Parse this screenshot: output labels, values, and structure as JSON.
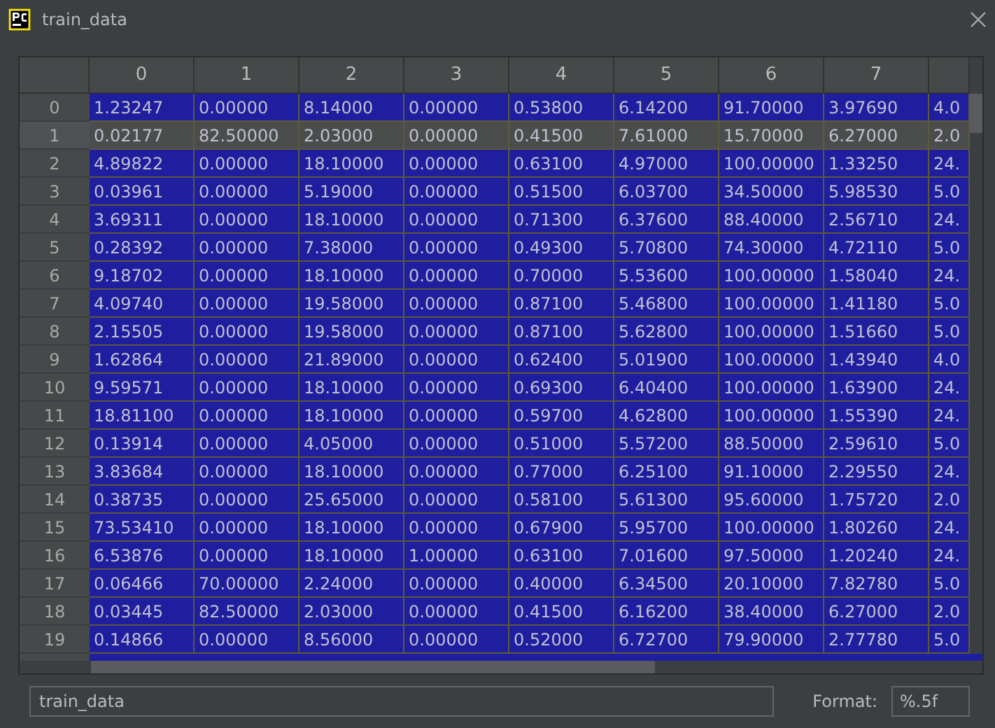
{
  "window": {
    "title": "train_data"
  },
  "table": {
    "columns": [
      "0",
      "1",
      "2",
      "3",
      "4",
      "5",
      "6",
      "7"
    ],
    "rows": [
      {
        "index": "0",
        "selected": false,
        "cells": [
          "1.23247",
          "0.00000",
          "8.14000",
          "0.00000",
          "0.53800",
          "6.14200",
          "91.70000",
          "3.97690",
          "4.0"
        ]
      },
      {
        "index": "1",
        "selected": true,
        "cells": [
          "0.02177",
          "82.50000",
          "2.03000",
          "0.00000",
          "0.41500",
          "7.61000",
          "15.70000",
          "6.27000",
          "2.0"
        ]
      },
      {
        "index": "2",
        "selected": false,
        "cells": [
          "4.89822",
          "0.00000",
          "18.10000",
          "0.00000",
          "0.63100",
          "4.97000",
          "100.00000",
          "1.33250",
          "24."
        ]
      },
      {
        "index": "3",
        "selected": false,
        "cells": [
          "0.03961",
          "0.00000",
          "5.19000",
          "0.00000",
          "0.51500",
          "6.03700",
          "34.50000",
          "5.98530",
          "5.0"
        ]
      },
      {
        "index": "4",
        "selected": false,
        "cells": [
          "3.69311",
          "0.00000",
          "18.10000",
          "0.00000",
          "0.71300",
          "6.37600",
          "88.40000",
          "2.56710",
          "24."
        ]
      },
      {
        "index": "5",
        "selected": false,
        "cells": [
          "0.28392",
          "0.00000",
          "7.38000",
          "0.00000",
          "0.49300",
          "5.70800",
          "74.30000",
          "4.72110",
          "5.0"
        ]
      },
      {
        "index": "6",
        "selected": false,
        "cells": [
          "9.18702",
          "0.00000",
          "18.10000",
          "0.00000",
          "0.70000",
          "5.53600",
          "100.00000",
          "1.58040",
          "24."
        ]
      },
      {
        "index": "7",
        "selected": false,
        "cells": [
          "4.09740",
          "0.00000",
          "19.58000",
          "0.00000",
          "0.87100",
          "5.46800",
          "100.00000",
          "1.41180",
          "5.0"
        ]
      },
      {
        "index": "8",
        "selected": false,
        "cells": [
          "2.15505",
          "0.00000",
          "19.58000",
          "0.00000",
          "0.87100",
          "5.62800",
          "100.00000",
          "1.51660",
          "5.0"
        ]
      },
      {
        "index": "9",
        "selected": false,
        "cells": [
          "1.62864",
          "0.00000",
          "21.89000",
          "0.00000",
          "0.62400",
          "5.01900",
          "100.00000",
          "1.43940",
          "4.0"
        ]
      },
      {
        "index": "10",
        "selected": false,
        "cells": [
          "9.59571",
          "0.00000",
          "18.10000",
          "0.00000",
          "0.69300",
          "6.40400",
          "100.00000",
          "1.63900",
          "24."
        ]
      },
      {
        "index": "11",
        "selected": false,
        "cells": [
          "18.81100",
          "0.00000",
          "18.10000",
          "0.00000",
          "0.59700",
          "4.62800",
          "100.00000",
          "1.55390",
          "24."
        ]
      },
      {
        "index": "12",
        "selected": false,
        "cells": [
          "0.13914",
          "0.00000",
          "4.05000",
          "0.00000",
          "0.51000",
          "5.57200",
          "88.50000",
          "2.59610",
          "5.0"
        ]
      },
      {
        "index": "13",
        "selected": false,
        "cells": [
          "3.83684",
          "0.00000",
          "18.10000",
          "0.00000",
          "0.77000",
          "6.25100",
          "91.10000",
          "2.29550",
          "24."
        ]
      },
      {
        "index": "14",
        "selected": false,
        "cells": [
          "0.38735",
          "0.00000",
          "25.65000",
          "0.00000",
          "0.58100",
          "5.61300",
          "95.60000",
          "1.75720",
          "2.0"
        ]
      },
      {
        "index": "15",
        "selected": false,
        "cells": [
          "73.53410",
          "0.00000",
          "18.10000",
          "0.00000",
          "0.67900",
          "5.95700",
          "100.00000",
          "1.80260",
          "24."
        ]
      },
      {
        "index": "16",
        "selected": false,
        "cells": [
          "6.53876",
          "0.00000",
          "18.10000",
          "1.00000",
          "0.63100",
          "7.01600",
          "97.50000",
          "1.20240",
          "24."
        ]
      },
      {
        "index": "17",
        "selected": false,
        "cells": [
          "0.06466",
          "70.00000",
          "2.24000",
          "0.00000",
          "0.40000",
          "6.34500",
          "20.10000",
          "7.82780",
          "5.0"
        ]
      },
      {
        "index": "18",
        "selected": false,
        "cells": [
          "0.03445",
          "82.50000",
          "2.03000",
          "0.00000",
          "0.41500",
          "6.16200",
          "38.40000",
          "6.27000",
          "2.0"
        ]
      },
      {
        "index": "19",
        "selected": false,
        "cells": [
          "0.14866",
          "0.00000",
          "8.56000",
          "0.00000",
          "0.52000",
          "6.72700",
          "79.90000",
          "2.77780",
          "5.0"
        ]
      }
    ]
  },
  "name_field": {
    "value": "train_data"
  },
  "format": {
    "label": "Format:",
    "value": "%.5f"
  }
}
